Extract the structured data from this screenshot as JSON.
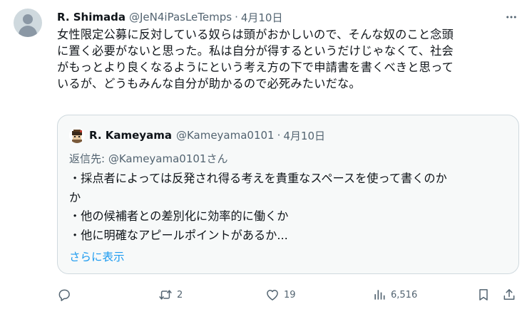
{
  "tweet": {
    "author_name": "R. Shimada",
    "author_handle": "@JeN4iPasLeTemps",
    "separator": "·",
    "date": "4月10日",
    "text_lines": [
      "女性限定公募に反対している奴らは頭がおかしいので、そんな奴のこと念頭",
      "に置く必要がないと思った。私は自分が得するというだけじゃなくて、社会",
      "がもっとより良くなるようにという考え方の下で申請書を書くべきと思って",
      "いるが、どうもみんな自分が助かるので必死みたいだな。"
    ]
  },
  "quote": {
    "author_name": "R. Kameyama",
    "author_handle": "@Kameyama0101",
    "separator": "·",
    "date": "4月10日",
    "reply_to": "返信先: @Kameyama0101さん",
    "text_lines": [
      "・採点者によっては反発され得る考えを貴重なスペースを使って書くのか",
      "か",
      "・他の候補者との差別化に効率的に働くか",
      "・他に明確なアピールポイントがあるか..."
    ],
    "show_more": "さらに表示"
  },
  "actions": {
    "reply_icon": "reply-icon",
    "retweet_icon": "retweet-icon",
    "retweet_count": "2",
    "like_icon": "heart-icon",
    "like_count": "19",
    "views_icon": "analytics-icon",
    "views_count": "6,516",
    "bookmark_icon": "bookmark-icon",
    "share_icon": "share-icon"
  },
  "colors": {
    "text": "#0f1419",
    "secondary": "#536471",
    "link": "#1d9bf0",
    "border": "#cfd9de"
  }
}
